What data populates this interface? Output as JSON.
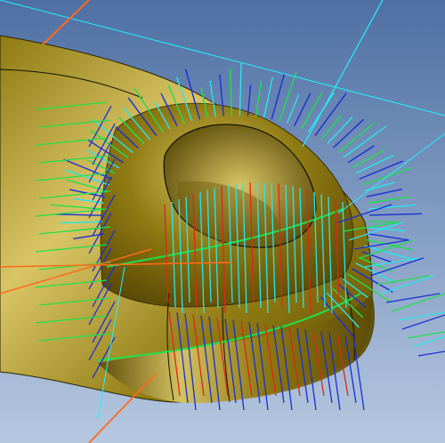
{
  "colors": {
    "background_top": "#4f70a4",
    "background_bottom": "#b6c8e0",
    "part_base": "#8f7a12",
    "part_highlight": "#d8c566",
    "part_shadow": "#5a4a06",
    "edge_line": "#111100",
    "normal_blue": "#1a2fd6",
    "normal_green": "#1fe04a",
    "normal_cyan": "#27e6ea",
    "normal_red": "#e0261a",
    "axis_orange": "#ff6a1a",
    "axis_cyan": "#1ff0ff"
  },
  "scene": {
    "object": "curved-shell-with-conical-boss",
    "overlays": [
      "surface-normal-vectors",
      "construction-axes"
    ]
  }
}
